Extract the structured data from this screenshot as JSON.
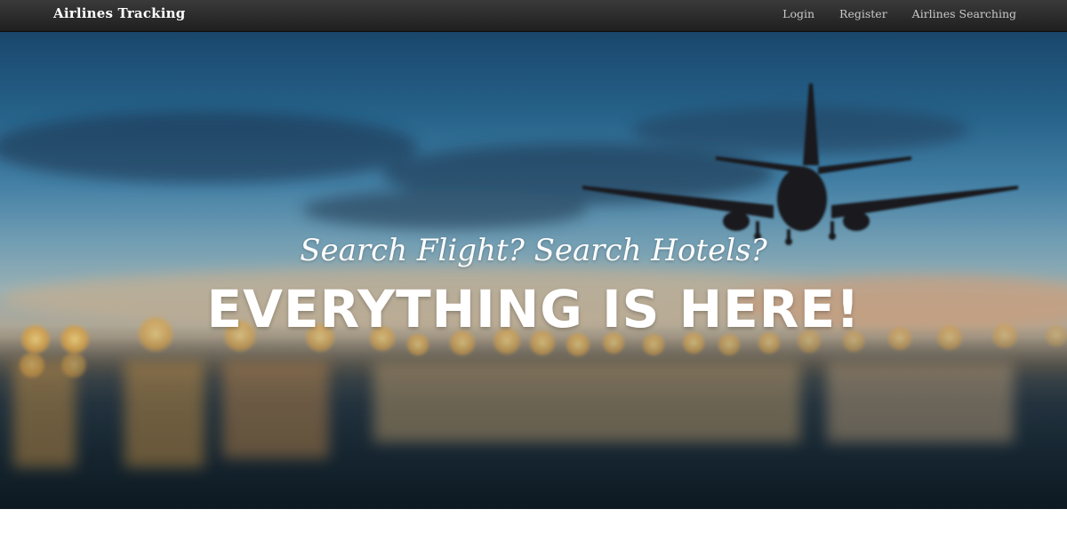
{
  "navbar": {
    "brand": "Airlines Tracking",
    "links": [
      {
        "label": "Login"
      },
      {
        "label": "Register"
      },
      {
        "label": "Airlines Searching"
      }
    ]
  },
  "hero": {
    "subtitle": "Search Flight? Search Hotels?",
    "title": "EVERYTHING IS HERE!",
    "background": "blurred sunset airport photo with airplane silhouette"
  },
  "colors": {
    "navbar": "#2a2a2a",
    "navbar_text": "#c9c9c9",
    "hero_text": "#ffffff"
  }
}
